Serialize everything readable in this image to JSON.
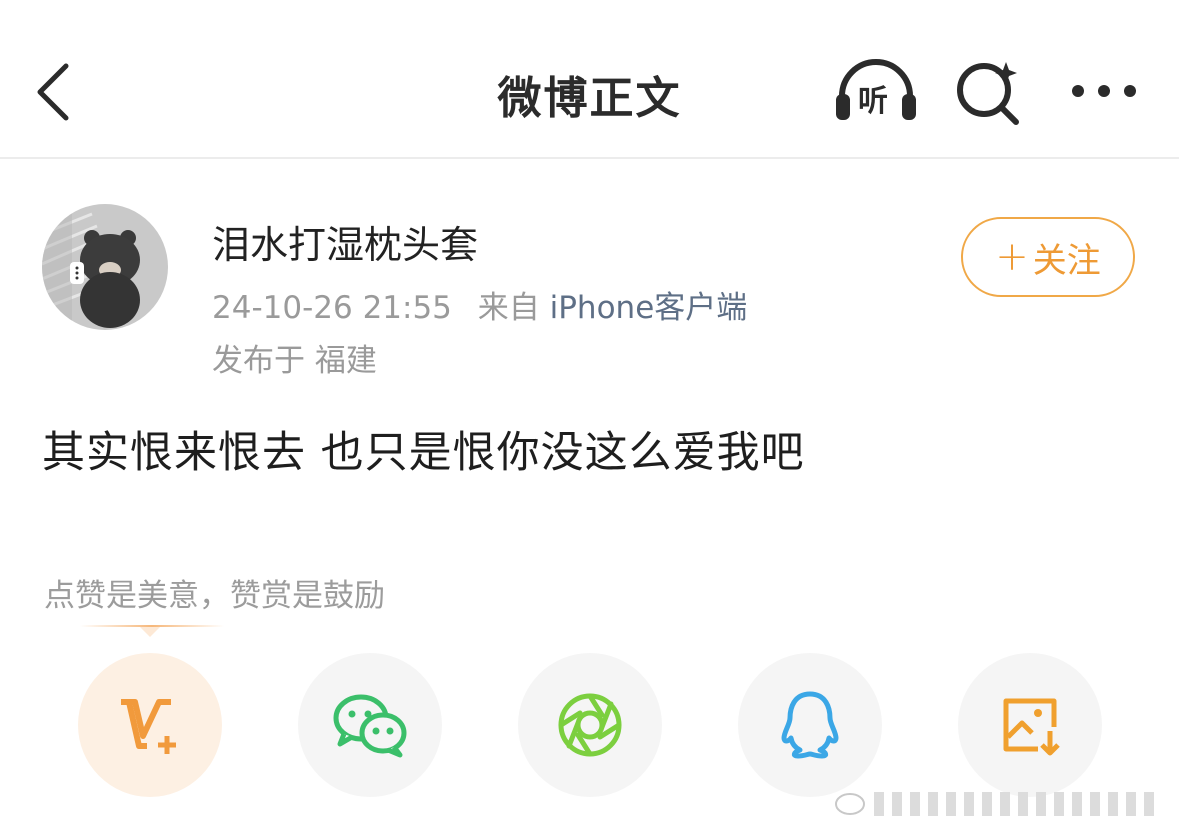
{
  "nav": {
    "title": "微博正文",
    "listen_label": "听"
  },
  "post": {
    "username": "泪水打湿枕头套",
    "datetime": "24-10-26 21:55",
    "source_prefix": "来自",
    "source_client": "iPhone客户端",
    "location": "发布于 福建",
    "follow_label": "关注",
    "content": "其实恨来恨去 也只是恨你没这么爱我吧"
  },
  "reward": {
    "text": "点赞是美意，赞赏是鼓励"
  },
  "share": {
    "icons": [
      "weibo-vplus-icon",
      "wechat-icon",
      "moments-icon",
      "qq-icon",
      "save-image-icon"
    ]
  },
  "colors": {
    "accent_orange": "#f0a847",
    "wechat_green": "#3bbf6a",
    "moments_green": "#7ccf3f",
    "qq_blue": "#3ba7e6",
    "client_blue": "#5e6f86"
  }
}
